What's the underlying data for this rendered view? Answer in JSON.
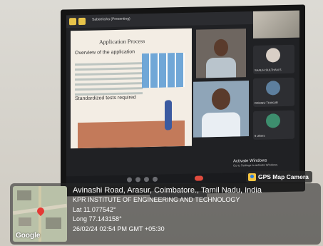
{
  "meeting": {
    "topbar_title": "Sabeeksha (Presenting)",
    "slide_heading": "Application Process",
    "slide_subheading": "Overview of the application",
    "slide_section": "Standardized tests required",
    "participants": [
      {
        "name": "SAALIH SULTHAN S"
      },
      {
        "name": "RISHNU THAKUR"
      },
      {
        "name": "6 others"
      }
    ],
    "activate_title": "Activate Windows",
    "activate_sub": "Go to Settings to activate Windows."
  },
  "gps": {
    "badge": "GPS Map Camera",
    "address": "Avinashi Road, Arasur, Coimbatore., Tamil Nadu, India",
    "place": "KPR INSTITUTE OF ENGINEERING AND TECHNOLOGY",
    "lat": "Lat 11.077542°",
    "long": "Long 77.143158°",
    "datetime": "26/02/24 02:54 PM GMT +05:30",
    "map_brand": "Google"
  }
}
